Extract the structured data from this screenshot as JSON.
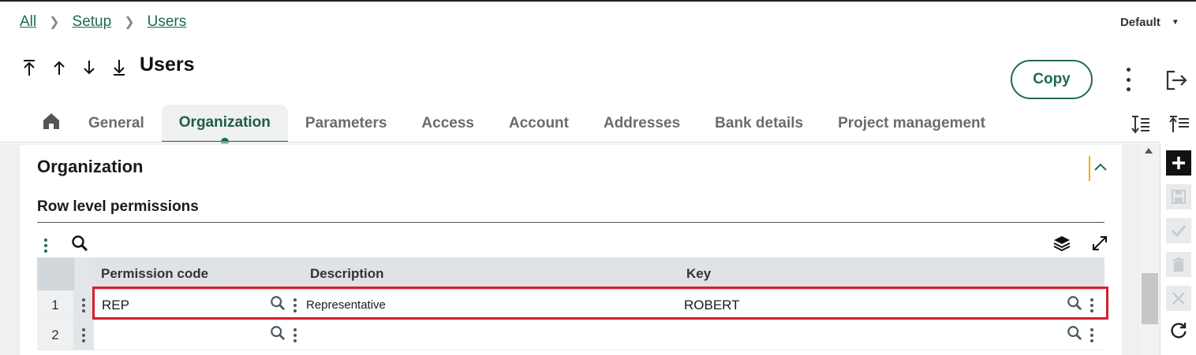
{
  "breadcrumb": {
    "items": [
      "All",
      "Setup",
      "Users"
    ]
  },
  "view_selector": {
    "label": "Default"
  },
  "page": {
    "title": "Users"
  },
  "actions": {
    "copy_label": "Copy"
  },
  "tabs": [
    {
      "label": "General"
    },
    {
      "label": "Organization",
      "active": true
    },
    {
      "label": "Parameters"
    },
    {
      "label": "Access"
    },
    {
      "label": "Account"
    },
    {
      "label": "Addresses"
    },
    {
      "label": "Bank details"
    },
    {
      "label": "Project management"
    }
  ],
  "section": {
    "title": "Organization",
    "subtitle": "Row level permissions"
  },
  "table": {
    "columns": [
      "Permission code",
      "Description",
      "Key"
    ],
    "rows": [
      {
        "num": "1",
        "code": "REP",
        "description": "Representative",
        "key": "ROBERT"
      },
      {
        "num": "2",
        "code": "",
        "description": "",
        "key": ""
      }
    ]
  },
  "colors": {
    "accent": "#1d6b4e",
    "highlight": "#d4202c",
    "collapse_marker": "#f0b000"
  },
  "icons": [
    "home-icon",
    "first-record-icon",
    "previous-record-icon",
    "next-record-icon",
    "last-record-icon",
    "more-actions-icon",
    "exit-icon",
    "sort-icon",
    "collapse-all-icon",
    "grid-menu-icon",
    "search-icon",
    "layers-icon",
    "expand-icon",
    "add-icon",
    "save-icon",
    "check-icon",
    "delete-icon",
    "cancel-icon",
    "refresh-icon"
  ]
}
